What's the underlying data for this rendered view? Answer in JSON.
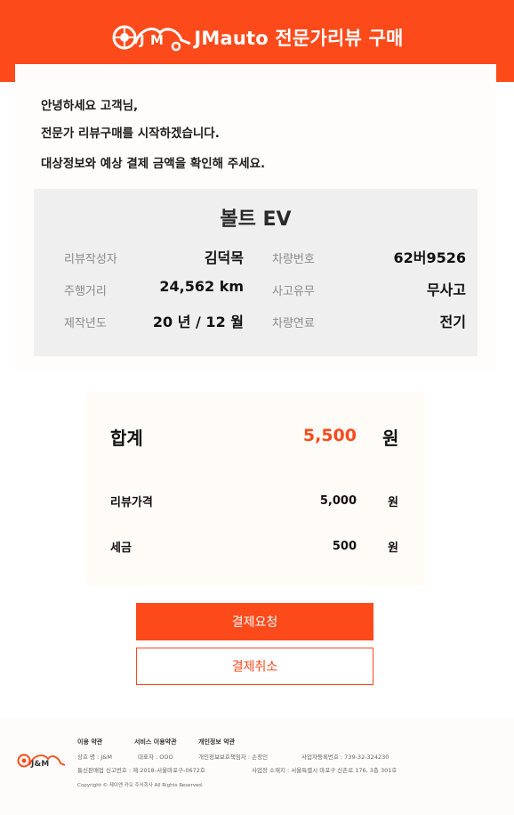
{
  "header": {
    "title": "JMauto 전문가리뷰 구매",
    "brand_color": "#fd4a1b",
    "logo_icon": "jm-car-logo-icon"
  },
  "greeting": {
    "line1": "안녕하세요 고객님,",
    "line2": "전문가 리뷰구매를 시작하겠습니다.",
    "line3": "대상정보와 예상 결제 금액을 확인해 주세요."
  },
  "vehicle": {
    "model": "볼트 EV",
    "fields": {
      "reviewer_label": "리뷰작성자",
      "reviewer": "김덕목",
      "plate_label": "차량번호",
      "plate": "62버9526",
      "mileage_label": "주행거리",
      "mileage": "24,562 km",
      "accident_label": "사고유무",
      "accident": "무사고",
      "year_label": "제작년도",
      "year": "20 년 / 12 월",
      "fuel_label": "차량연료",
      "fuel": "전기"
    }
  },
  "summary": {
    "total_label": "합계",
    "total_value": "5,500",
    "total_unit": "원",
    "review_label": "리뷰가격",
    "review_value": "5,000",
    "review_unit": "원",
    "tax_label": "세금",
    "tax_value": "500",
    "tax_unit": "원",
    "accent_color": "#fd4a1b"
  },
  "buttons": {
    "pay": "결제요청",
    "cancel": "결제취소"
  },
  "footer": {
    "links": [
      "이용 약관",
      "서비스 이용약관",
      "개인정보 약관"
    ],
    "company": "상호 명 : J&M",
    "ceo": "대표자 : OOO",
    "privacy_officer": "개인정보보호책임자 : 손정인",
    "biz_no": "사업자등록번호 : 739-32-324230",
    "mail_order": "통신판매업 신고번호 : 제 2018-서울마포구-0672호",
    "address": "사업장 소재지 : 서울특별시 마포구 신촌로 176, 3층 301호",
    "copyright": "Copyright © 제이엔 카오 주식회사 All Rights Reserved."
  }
}
